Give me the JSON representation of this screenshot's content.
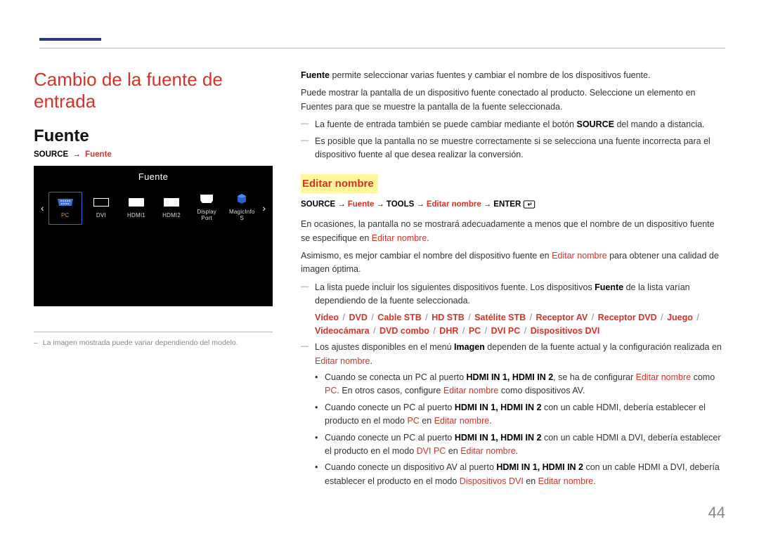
{
  "page_number": "44",
  "section": {
    "title": "Cambio de la fuente de entrada",
    "sub_title": "Fuente"
  },
  "left": {
    "breadcrumb_source": "SOURCE",
    "breadcrumb_fuente": "Fuente",
    "ui_title": "Fuente",
    "items": [
      "PC",
      "DVI",
      "HDMI1",
      "HDMI2",
      "Display Port",
      "MagicInfo S"
    ],
    "note_prefix": "– ",
    "note": "La imagen mostrada puede variar dependiendo del modelo."
  },
  "right": {
    "intro_accent": "Fuente",
    "intro_rest": " permite seleccionar varias fuentes y cambiar el nombre de los dispositivos fuente.",
    "para2": "Puede mostrar la pantalla de un dispositivo fuente conectado al producto. Seleccione un elemento en Fuentes para que se muestre la pantalla de la fuente seleccionada.",
    "dash1_pre": "La fuente de entrada también se puede cambiar mediante el botón ",
    "dash1_bold": "SOURCE",
    "dash1_post": " del mando a distancia.",
    "dash2": "Es posible que la pantalla no se muestre correctamente si se selecciona una fuente incorrecta para el dispositivo fuente al que desea realizar la conversión.",
    "editar_title": "Editar nombre",
    "bc2_source": "SOURCE",
    "bc2_fuente": "Fuente",
    "bc2_tools": "TOOLS",
    "bc2_editar": "Editar nombre",
    "bc2_enter": "ENTER",
    "p3_pre": "En ocasiones, la pantalla no se mostrará adecuadamente a menos que el nombre de un dispositivo fuente se especifique en ",
    "p3_accent": "Editar nombre",
    "p3_post": ".",
    "p4_pre": "Asimismo, es mejor cambiar el nombre del dispositivo fuente en ",
    "p4_accent": "Editar nombre",
    "p4_post": " para obtener una calidad de imagen óptima.",
    "dash3_pre": "La lista puede incluir los siguientes dispositivos fuente. Los dispositivos ",
    "dash3_accent": "Fuente",
    "dash3_post": " de la lista varían dependiendo de la fuente seleccionada.",
    "devices": [
      "Vídeo",
      "DVD",
      "Cable STB",
      "HD STB",
      "Satélite STB",
      "Receptor AV",
      "Receptor DVD",
      "Juego",
      "Videocámara",
      "DVD combo",
      "DHR",
      "PC",
      "DVI PC",
      "Dispositivos DVI"
    ],
    "dash4_pre": "Los ajustes disponibles en el menú ",
    "dash4_bold": "Imagen",
    "dash4_mid": " dependen de la fuente actual y la configuración realizada en ",
    "dash4_accent": "Editar nombre",
    "dash4_post": ".",
    "b1_pre": "Cuando se conecta un PC al puerto ",
    "b1_bold": "HDMI IN 1, HDMI IN 2",
    "b1_mid": ", se ha de configurar ",
    "b1_a1": "Editar nombre",
    "b1_mid2": " como ",
    "b1_a2": "PC",
    "b1_post": ". En otros casos, configure ",
    "b1_a3": "Editar nombre",
    "b1_end": " como dispositivos AV.",
    "b2_pre": "Cuando conecte un PC al puerto ",
    "b2_bold": "HDMI IN 1, HDMI IN 2",
    "b2_mid": " con un cable HDMI, debería establecer el producto en el modo ",
    "b2_a1": "PC",
    "b2_mid2": " en ",
    "b2_a2": "Editar nombre",
    "b2_post": ".",
    "b3_pre": "Cuando conecte un PC al puerto ",
    "b3_bold": "HDMI IN 1, HDMI IN 2",
    "b3_mid": " con un cable HDMI a DVI, debería establecer el producto en el modo ",
    "b3_a1": "DVI PC",
    "b3_mid2": " en ",
    "b3_a2": "Editar nombre",
    "b3_post": ".",
    "b4_pre": "Cuando conecte un dispositivo AV al puerto ",
    "b4_bold": "HDMI IN 1, HDMI IN 2",
    "b4_mid": " con un cable HDMI a DVI, debería establecer el producto en el modo ",
    "b4_a1": "Dispositivos DVI",
    "b4_mid2": " en ",
    "b4_a2": "Editar nombre",
    "b4_post": "."
  }
}
